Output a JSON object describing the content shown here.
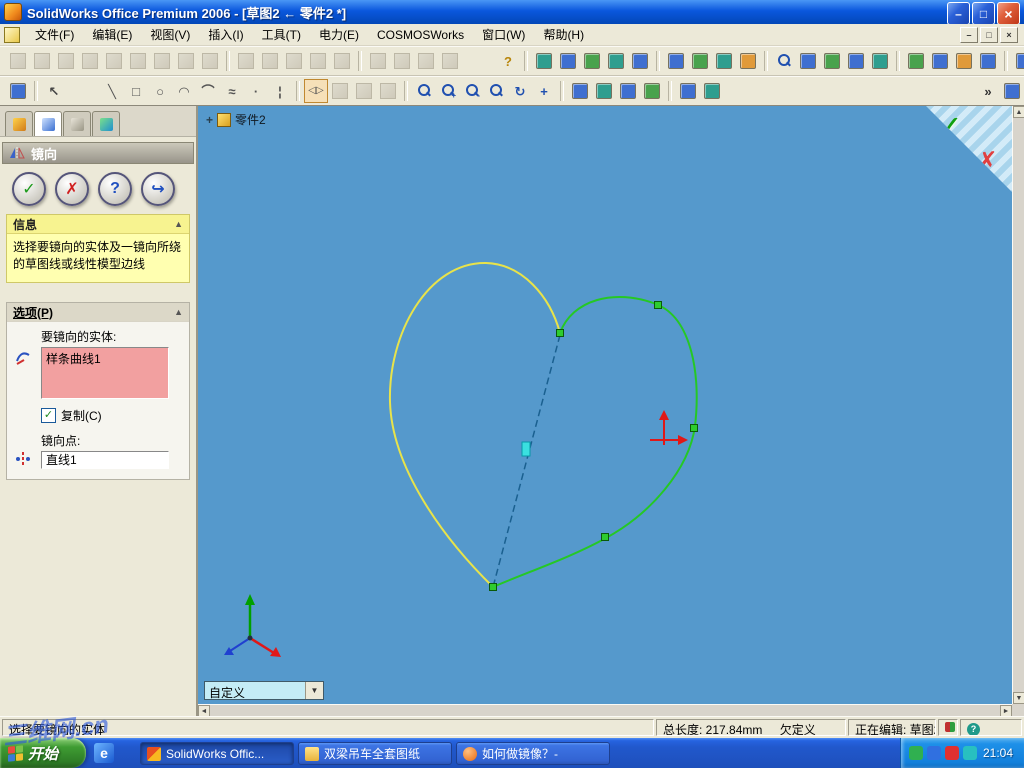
{
  "titlebar": {
    "title": "SolidWorks Office Premium 2006 - [草图2 ← 零件2 *]"
  },
  "menubar": {
    "items": [
      "文件(F)",
      "编辑(E)",
      "视图(V)",
      "插入(I)",
      "工具(T)",
      "电力(E)",
      "COSMOSWorks",
      "窗口(W)",
      "帮助(H)"
    ]
  },
  "panel": {
    "title": "镜向",
    "info_header": "信息",
    "info_text": "选择要镜向的实体及一镜向所绕的草图线或线性模型边线",
    "options_header": "选项(P)",
    "entities_label": "要镜向的实体:",
    "entities_item": "样条曲线1",
    "copy_label": "复制(C)",
    "mirror_point_label": "镜向点:",
    "mirror_point_value": "直线1"
  },
  "canvas": {
    "part_label": "零件2",
    "view_combo": "自定义"
  },
  "status": {
    "hint": "选择要镜向的实体",
    "length": "总长度: 217.84mm",
    "definition": "欠定义",
    "editing": "正在编辑: 草图2"
  },
  "taskbar": {
    "start": "开始",
    "tasks": [
      {
        "label": "SolidWorks Offic..."
      },
      {
        "label": "双梁吊车全套图纸"
      },
      {
        "label": "如何做镜像？-"
      }
    ],
    "time": "21:04"
  },
  "watermark": "三维网.cn",
  "glyphs": {
    "ok": "✓",
    "cancel": "✗",
    "help": "?",
    "keep_visible": "↪",
    "collapse": "▲",
    "dropdown": "▼",
    "scroll_left": "◄",
    "scroll_right": "►",
    "scroll_up": "▲",
    "scroll_down": "▼",
    "overflow": "»",
    "min": "–",
    "max": "□",
    "close": "×",
    "plus": "+",
    "mirror_tool": "◁▷",
    "ie": "e"
  },
  "toolbars": {
    "row1": [
      {
        "k": "g"
      },
      {
        "k": "g"
      },
      {
        "k": "g"
      },
      {
        "k": "g"
      },
      {
        "k": "g"
      },
      {
        "k": "g"
      },
      {
        "k": "g"
      },
      {
        "k": "g"
      },
      {
        "k": "g"
      },
      {
        "k": "sep"
      },
      {
        "k": "g"
      },
      {
        "k": "g"
      },
      {
        "k": "g"
      },
      {
        "k": "g"
      },
      {
        "k": "g"
      },
      {
        "k": "sep"
      },
      {
        "k": "g"
      },
      {
        "k": "g"
      },
      {
        "k": "g"
      },
      {
        "k": "g"
      },
      {
        "k": "gap"
      },
      {
        "k": "gl",
        "ch": "?",
        "c": "#b8860b"
      },
      {
        "k": "sep"
      },
      {
        "k": "c",
        "c": "#2f9e8f"
      },
      {
        "k": "c",
        "c": "#3f6fd0"
      },
      {
        "k": "c",
        "c": "#49a24d"
      },
      {
        "k": "c",
        "c": "#2f9e8f"
      },
      {
        "k": "c",
        "c": "#3f6fd0"
      },
      {
        "k": "sep"
      },
      {
        "k": "c",
        "c": "#3f6fd0"
      },
      {
        "k": "c",
        "c": "#49a24d"
      },
      {
        "k": "c",
        "c": "#2f9e8f"
      },
      {
        "k": "c",
        "c": "#e09a3a"
      },
      {
        "k": "sep"
      },
      {
        "k": "mag"
      },
      {
        "k": "c",
        "c": "#3f6fd0"
      },
      {
        "k": "c",
        "c": "#49a24d"
      },
      {
        "k": "c",
        "c": "#3f6fd0"
      },
      {
        "k": "c",
        "c": "#2f9e8f"
      },
      {
        "k": "sep"
      },
      {
        "k": "c",
        "c": "#49a24d"
      },
      {
        "k": "c",
        "c": "#3f6fd0"
      },
      {
        "k": "c",
        "c": "#e09a3a"
      },
      {
        "k": "c",
        "c": "#3f6fd0"
      },
      {
        "k": "sep"
      },
      {
        "k": "c",
        "c": "#3f6fd0"
      },
      {
        "k": "c",
        "c": "#2f9e8f"
      },
      {
        "k": "c",
        "c": "#49a24d"
      },
      {
        "k": "spring"
      },
      {
        "k": "g"
      },
      {
        "k": "g"
      }
    ],
    "row2": [
      {
        "k": "c",
        "c": "#3f6fd0"
      },
      {
        "k": "sep"
      },
      {
        "k": "gl",
        "ch": "↖",
        "c": "#444"
      },
      {
        "k": "gap"
      },
      {
        "k": "gl",
        "ch": "╲",
        "c": "#555"
      },
      {
        "k": "gl",
        "ch": "□",
        "c": "#555"
      },
      {
        "k": "gl",
        "ch": "○",
        "c": "#555"
      },
      {
        "k": "gl",
        "ch": "◠",
        "c": "#555"
      },
      {
        "k": "gl",
        "ch": "⌒",
        "c": "#555"
      },
      {
        "k": "gl",
        "ch": "≈",
        "c": "#555"
      },
      {
        "k": "gl",
        "ch": "·",
        "c": "#555"
      },
      {
        "k": "gl",
        "ch": "¦",
        "c": "#555"
      },
      {
        "k": "sep"
      },
      {
        "k": "mirror"
      },
      {
        "k": "g"
      },
      {
        "k": "g"
      },
      {
        "k": "g"
      },
      {
        "k": "sep"
      },
      {
        "k": "mag"
      },
      {
        "k": "mag+"
      },
      {
        "k": "mag-"
      },
      {
        "k": "mag"
      },
      {
        "k": "gl",
        "ch": "↻",
        "c": "#2050b0"
      },
      {
        "k": "gl",
        "ch": "+",
        "c": "#2050b0"
      },
      {
        "k": "sep"
      },
      {
        "k": "c",
        "c": "#3f6fd0"
      },
      {
        "k": "c",
        "c": "#2f9e8f"
      },
      {
        "k": "c",
        "c": "#3f6fd0"
      },
      {
        "k": "c",
        "c": "#49a24d"
      },
      {
        "k": "sep"
      },
      {
        "k": "c",
        "c": "#3f6fd0"
      },
      {
        "k": "c",
        "c": "#2f9e8f"
      },
      {
        "k": "spring"
      },
      {
        "k": "gl",
        "ch": "»",
        "c": "#333"
      },
      {
        "k": "c",
        "c": "#3f6fd0"
      }
    ]
  }
}
